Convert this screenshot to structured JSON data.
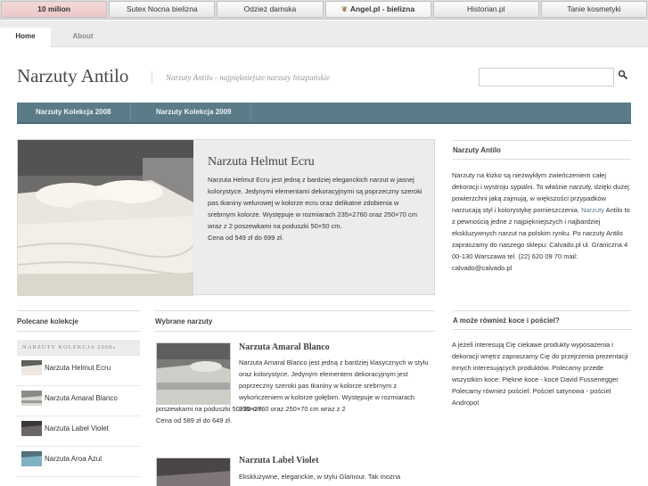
{
  "top_links": [
    "10 milion",
    "Sutex Nocna bielizna",
    "Odzież damska",
    "Angel.pl - bielizna",
    "Historian.pl",
    "Tanie kosmetyki"
  ],
  "tabs": [
    "Home",
    "About"
  ],
  "header": {
    "title": "Narzuty Antilo",
    "tagline": "Narzuty Antilo - najpiękniejsze narzuty hiszpańskie"
  },
  "search": {
    "placeholder": ""
  },
  "categories": [
    "Narzuty Kolekcja 2008",
    "Narzuty Kolekcja 2009"
  ],
  "featured": {
    "title": "Narzuta Helmut Ecru",
    "text": "Narzuta Helmut Ecru jest jedną z bardziej eleganckich narzut w jasnej kolorystyce. Jedynymi elementami dekoracyjnymi są poprzeczny szeroki pas tkaniny welurowej w kolorze ecru oraz delikatne zdobienia w srebrnym kolorze. Występuje w rozmiarach 235×2760 oraz 250×70 cm wraz z 2 poszewkami na poduszki 50×50 cm.",
    "price": "Cena od 549 zł do 699 zł."
  },
  "sidebar": {
    "about_title": "Narzuty Antilo",
    "about_text_1": "Narzuty na łóżko są niezwykłym zwieńczeniem całej dekoracji i wystroju sypialni. To właśnie narzuty, dzięki dużej powierzchni jaką zajmują, w większości przypadków narzucają styl i kolorystykę pomieszczenia.",
    "about_link": "Narzuty",
    "about_text_2": "Antilo to z pewnością jedne z najpiękniejszych i najbardziej ekskluzywnych narzut na polskim rynku. Po narzuty Antilo zapraszamy do naszego sklepu: Calvado.pl ul. Graniczna 4 00-130 Warszawa tel. (22) 620 09 70 mail: calvado@calvado.pl",
    "more_title": "A może również koce i pościel?",
    "more_text": "A jeżeli interesują Cię ciekawe produkty wyposażenia i dekoracji wnętrz zapraszamy Cię do przejrzenia prezentacji innych interesujących produktów. Polecamy przede wszystkim koce: Piękne koce - koce David Fussenegger Polecamy również pościel: Pościel satynowa - pościel Andropol"
  },
  "left_column": {
    "title": "Polecane kolekcje",
    "subtitle": "NARZUTY KOLEKCJA 2008»",
    "items": [
      "Narzuta Helmut Ecru",
      "Narzuta Amaral Blanco",
      "Narzuta Label Violet",
      "Narzuta Aroa Azul"
    ]
  },
  "middle_column": {
    "title": "Wybrane narzuty",
    "products": [
      {
        "title": "Narzuta Amaral Blanco",
        "text": "Narzuta Amaral Blanco jest jedną z bardziej klasycznych w stylu oraz kolorystyce. Jedynym elementem dekoracyjnym jest poprzeczny szeroki pas tkaniny w kolorze srebrnym z wykończeniem w kolorze gołębim. Występuje w rozmiarach 235×2760 oraz 250×70 cm wraz z 2",
        "cont": "poszewkami na poduszki 50×50 cm.",
        "price": "Cena od 589 zł do 649 zł."
      },
      {
        "title": "Narzuta Label Violet",
        "text": "Ekskluzywne, eleganckie, w stylu Glamour. Tak można"
      }
    ]
  },
  "colors": {
    "accent": "#5b7b89",
    "top_highlight": "#f0d0d0",
    "panel_bg": "#ececec"
  }
}
